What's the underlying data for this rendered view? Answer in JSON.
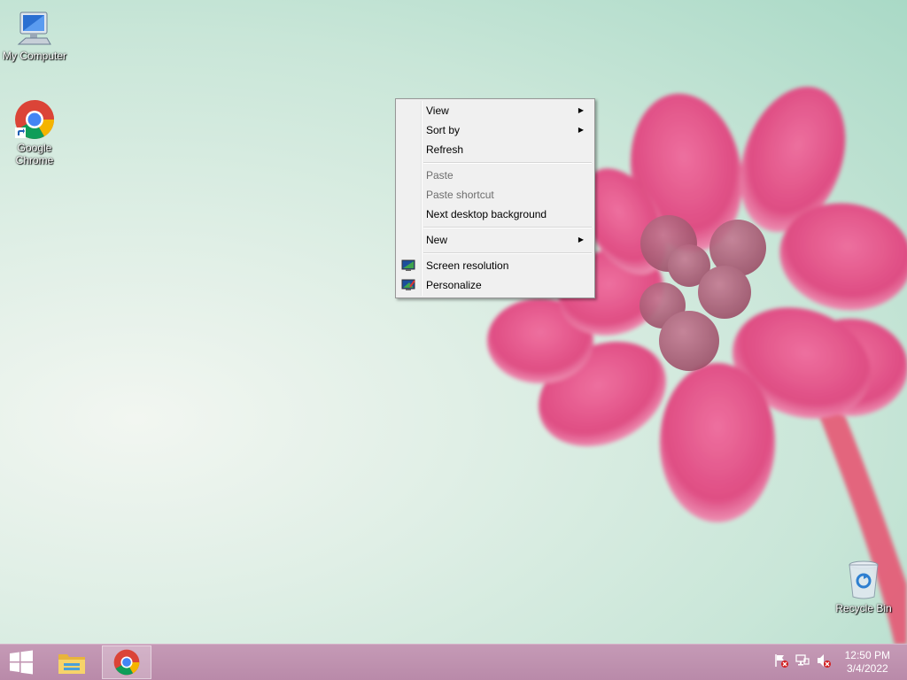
{
  "desktop": {
    "icons": [
      {
        "label": "My Computer"
      },
      {
        "label": "Google Chrome"
      },
      {
        "label": "Recycle Bin"
      }
    ]
  },
  "context_menu": {
    "items": [
      {
        "label": "View",
        "submenu": true,
        "enabled": true
      },
      {
        "label": "Sort by",
        "submenu": true,
        "enabled": true
      },
      {
        "label": "Refresh",
        "submenu": false,
        "enabled": true
      },
      {
        "label": "Paste",
        "submenu": false,
        "enabled": false
      },
      {
        "label": "Paste shortcut",
        "submenu": false,
        "enabled": false
      },
      {
        "label": "Next desktop background",
        "submenu": false,
        "enabled": true
      },
      {
        "label": "New",
        "submenu": true,
        "enabled": true
      },
      {
        "label": "Screen resolution",
        "submenu": false,
        "enabled": true,
        "icon": "monitor-icon"
      },
      {
        "label": "Personalize",
        "submenu": false,
        "enabled": true,
        "icon": "personalize-icon"
      }
    ],
    "submenu_arrow": "▶"
  },
  "taskbar": {
    "buttons": [
      "windows-start-icon",
      "file-explorer-icon",
      "chrome-icon"
    ],
    "tray_icons": [
      "action-center-flag-icon",
      "network-icon",
      "volume-muted-icon"
    ],
    "clock": {
      "time": "12:50 PM",
      "date": "3/4/2022"
    }
  },
  "colors": {
    "taskbar": "#b98aa9",
    "flower": "#e0457f",
    "menu_bg": "#f0f0f0"
  }
}
